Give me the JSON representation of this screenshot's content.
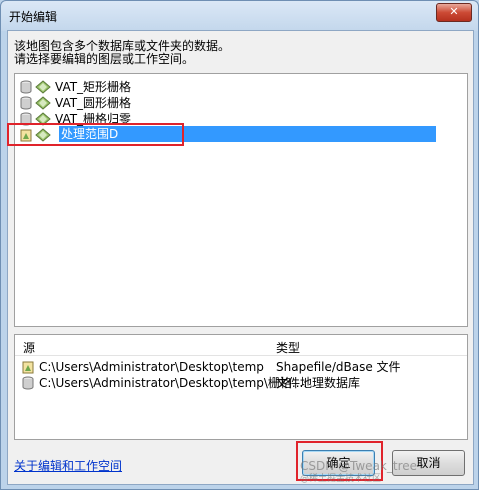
{
  "window": {
    "title": "开始编辑",
    "close_glyph": "✕"
  },
  "description": {
    "line1": "该地图包含多个数据库或文件夹的数据。",
    "line2": "请选择要编辑的图层或工作空间。"
  },
  "layers": [
    {
      "label": "VAT_矩形栅格"
    },
    {
      "label": "VAT_圆形栅格"
    },
    {
      "label": "VAT_栅格归零"
    },
    {
      "label": "处理范围D"
    }
  ],
  "table": {
    "col_source": "源",
    "col_type": "类型",
    "rows": [
      {
        "source": "C:\\Users\\Administrator\\Desktop\\temp",
        "type": "Shapefile/dBase 文件"
      },
      {
        "source": "C:\\Users\\Administrator\\Desktop\\temp\\栅格....",
        "type": "文件地理数据库"
      }
    ]
  },
  "footer": {
    "link": "关于编辑和工作空间",
    "ok": "确定",
    "cancel": "取消"
  },
  "watermark": {
    "text": "CSDN @Tweak_tree",
    "sub": "@稀土掘金技术社区"
  },
  "colors": {
    "selection": "#3399ff",
    "highlight_box": "#e0232b",
    "link": "#0033cc"
  }
}
